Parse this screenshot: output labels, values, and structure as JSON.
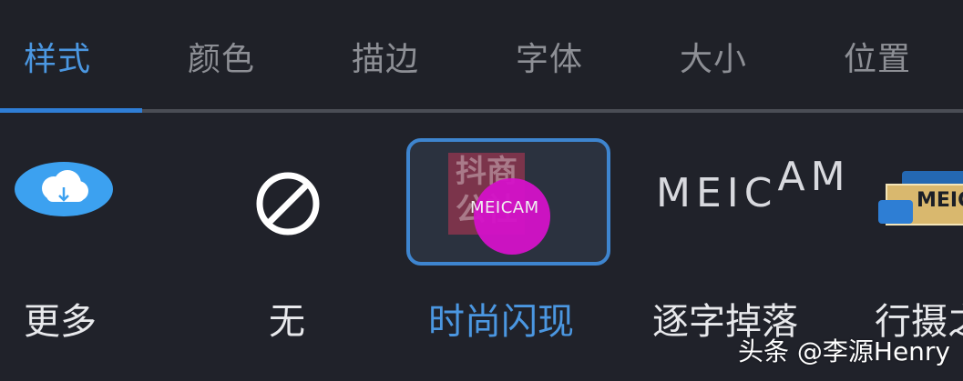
{
  "tabs": [
    {
      "label": "样式",
      "active": true
    },
    {
      "label": "颜色",
      "active": false
    },
    {
      "label": "描边",
      "active": false
    },
    {
      "label": "字体",
      "active": false
    },
    {
      "label": "大小",
      "active": false
    },
    {
      "label": "位置",
      "active": false
    }
  ],
  "colors": {
    "active_tab": "#4b97e1",
    "underline": "#2f7ed6",
    "background": "#20222a",
    "selected_border": "#3e85cf",
    "magenta": "#d412c8",
    "cloud": "#3ca1f0"
  },
  "items": [
    {
      "label": "更多",
      "icon": "cloud-download-icon"
    },
    {
      "label": "无",
      "icon": "none-icon"
    },
    {
      "label": "时尚闪现",
      "icon": "flash-style-preview-icon",
      "preview_text": "MEICAM",
      "selected": true
    },
    {
      "label": "逐字掉落",
      "icon": "meicam-word-drop-icon",
      "preview_text": "MEICAM"
    },
    {
      "label": "行摄之",
      "icon": "photo-style-icon",
      "preview_text": "MEIC"
    }
  ],
  "watermark": "头条 @李源Henry"
}
